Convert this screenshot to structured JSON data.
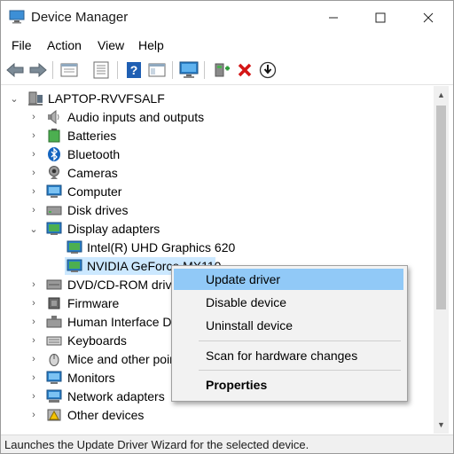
{
  "window": {
    "title": "Device Manager",
    "icon": "device-manager-icon",
    "controls": [
      "minimize-icon",
      "maximize-icon",
      "close-icon"
    ]
  },
  "menu": [
    "File",
    "Action",
    "View",
    "Help"
  ],
  "toolbar": [
    "back-arrow-icon",
    "forward-arrow-icon",
    "properties-sheet-icon",
    "details-list-icon",
    "help-icon",
    "console-tree-icon",
    "monitor-scan-icon",
    "add-driver-icon",
    "uninstall-x-icon",
    "update-driver-icon"
  ],
  "tree": {
    "root": "LAPTOP-RVVFSALF",
    "categories": {
      "audio": "Audio inputs and outputs",
      "batteries": "Batteries",
      "bluetooth": "Bluetooth",
      "cameras": "Cameras",
      "computer": "Computer",
      "disk_drives": "Disk drives",
      "display_adapters": "Display adapters",
      "intel_gpu": "Intel(R) UHD Graphics 620",
      "nvidia_gpu": "NVIDIA GeForce MX110",
      "dvd": "DVD/CD-ROM drives",
      "firmware": "Firmware",
      "hid": "Human Interface Devices",
      "keyboards": "Keyboards",
      "mice": "Mice and other pointing devices",
      "monitors": "Monitors",
      "network": "Network adapters",
      "other": "Other devices"
    }
  },
  "context_menu": {
    "update_driver": "Update driver",
    "disable_device": "Disable device",
    "uninstall_device": "Uninstall device",
    "scan_hardware": "Scan for hardware changes",
    "properties": "Properties"
  },
  "status": "Launches the Update Driver Wizard for the selected device.",
  "colors": {
    "selection": "#cce8ff",
    "menu_highlight": "#91c9f7",
    "monitor_blue": "#2a7fc7",
    "uninstall_red": "#d41616"
  }
}
